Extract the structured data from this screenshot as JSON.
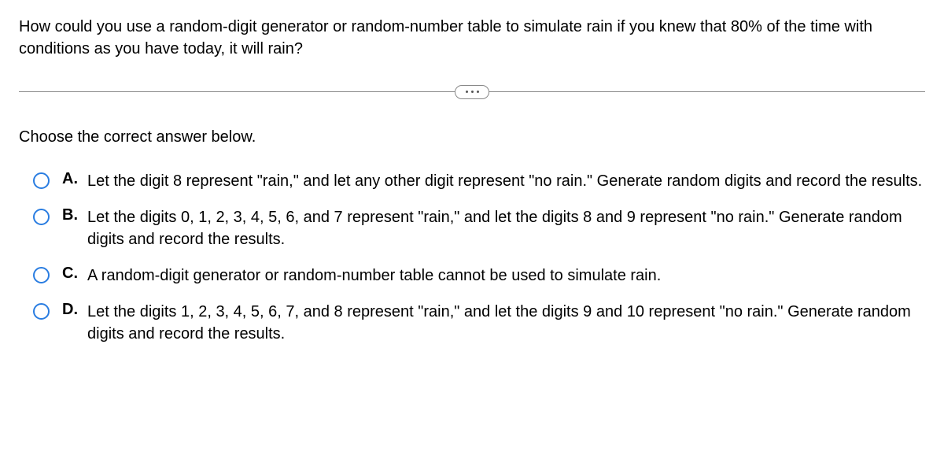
{
  "question": "How could you use a random-digit generator or random-number table to simulate rain if you knew that 80% of the time with conditions as you have today, it will rain?",
  "instruction": "Choose the correct answer below.",
  "options": [
    {
      "letter": "A.",
      "text": "Let the digit 8 represent \"rain,\" and let any other digit represent \"no rain.\"  Generate random digits and record the results."
    },
    {
      "letter": "B.",
      "text": "Let the digits 0, 1, 2, 3, 4, 5, 6, and 7 represent \"rain,\" and let the digits 8 and 9 represent \"no rain.\"  Generate random digits and record the results."
    },
    {
      "letter": "C.",
      "text": "A random-digit generator or random-number table cannot be used to simulate rain."
    },
    {
      "letter": "D.",
      "text": "Let the digits 1, 2, 3, 4, 5, 6, 7, and 8 represent \"rain,\" and let the digits 9 and 10 represent \"no rain.\"  Generate random digits and record the results."
    }
  ]
}
